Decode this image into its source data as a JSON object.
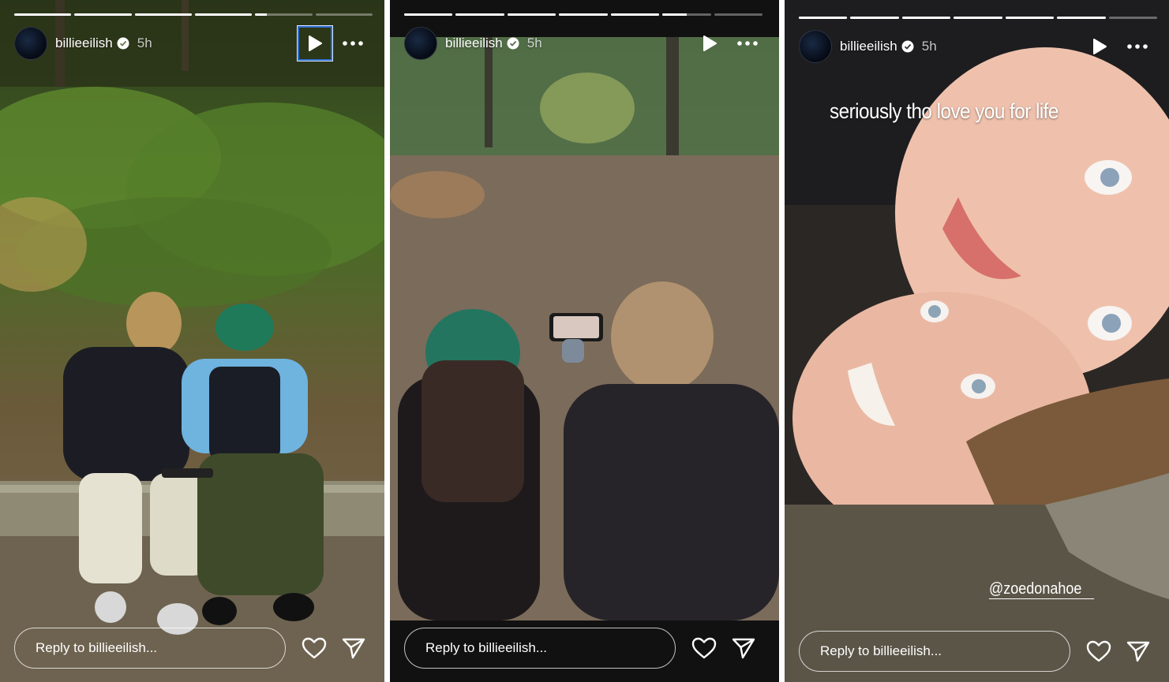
{
  "stories": [
    {
      "username": "billieeilish",
      "time": "5h",
      "reply_placeholder": "Reply to billieeilish...",
      "progress": [
        1,
        1,
        1,
        1,
        0.2,
        0,
        0
      ],
      "icons": {
        "play": "play-icon",
        "more": "more-icon",
        "like": "heart-icon",
        "share": "send-icon",
        "verified": "verified-badge-icon"
      }
    },
    {
      "username": "billieeilish",
      "time": "5h",
      "reply_placeholder": "Reply to billieeilish...",
      "progress": [
        1,
        1,
        1,
        1,
        1,
        0.5,
        0
      ],
      "icons": {
        "play": "play-icon",
        "more": "more-icon",
        "like": "heart-icon",
        "share": "send-icon",
        "verified": "verified-badge-icon"
      }
    },
    {
      "username": "billieeilish",
      "time": "5h",
      "reply_placeholder": "Reply to billieeilish...",
      "progress": [
        1,
        1,
        1,
        1,
        1,
        1,
        0
      ],
      "caption": "seriously tho love you for life",
      "mention": "@zoedonahoe",
      "icons": {
        "play": "play-icon",
        "more": "more-icon",
        "like": "heart-icon",
        "share": "send-icon",
        "verified": "verified-badge-icon"
      }
    }
  ]
}
